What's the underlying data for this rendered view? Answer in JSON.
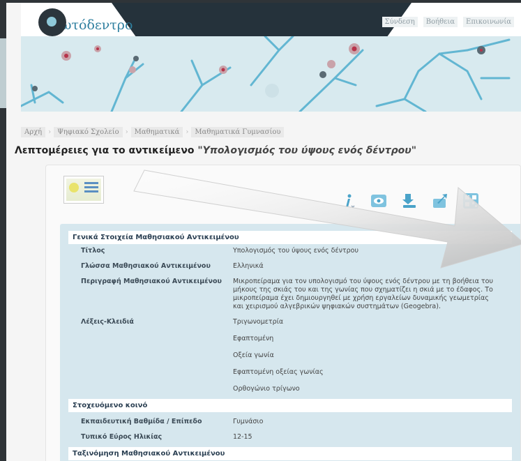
{
  "header": {
    "logo_text": "ωτόδεντρο",
    "links": [
      "Σύνδεση",
      "Βοήθεια",
      "Επικοινωνία"
    ]
  },
  "breadcrumb": [
    "Αρχή",
    "Ψηφιακό Σχολείο",
    "Μαθηματικά",
    "Μαθηματικά Γυμνασίου"
  ],
  "title": {
    "prefix": "Λεπτομέρειες για το αντικείμενο",
    "object": "\"Υπολογισμός του ύψους ενός δέντρου\""
  },
  "actions": [
    {
      "name": "info-icon"
    },
    {
      "name": "preview-icon"
    },
    {
      "name": "download-icon"
    },
    {
      "name": "share-icon"
    },
    {
      "name": "qr-icon"
    }
  ],
  "metadata": {
    "section_general": "Γενικά Στοιχεία Μαθησιακού Αντικειμένου",
    "title_label": "Τίτλος",
    "title_value": "Υπολογισμός του ύψους ενός δέντρου",
    "language_label": "Γλώσσα Μαθησιακού Αντικειμένου",
    "language_value": "Ελληνικά",
    "description_label": "Περιγραφή Μαθησιακού Αντικειμένου",
    "description_value": "Μικροπείραμα για τον υπολογισμό του ύψους ενός δέντρου με τη βοήθεια του μήκους της σκιάς του και της γωνίας που σχηματίζει η σκιά με το έδαφος. Το μικροπείραμα έχει δημιουργηθεί με χρήση εργαλείων δυναμικής γεωμετρίας και χειρισμού αλγεβρικών ψηφιακών συστημάτων (Geogebra).",
    "keywords_label": "Λέξεις-Κλειδιά",
    "keywords": [
      "Τριγωνομετρία",
      "Εφαπτομένη",
      "Οξεία γωνία",
      "Εφαπτομένη οξείας γωνίας",
      "Ορθογώνιο τρίγωνο"
    ],
    "section_audience": "Στοχευόμενο κοινό",
    "level_label": "Εκπαιδευτική Βαθμίδα / Επίπεδο",
    "level_value": "Γυμνάσιο",
    "age_label": "Τυπικό Εύρος Ηλικίας",
    "age_value": "12-15",
    "section_classification": "Ταξινόμηση Μαθησιακού Αντικειμένου"
  }
}
